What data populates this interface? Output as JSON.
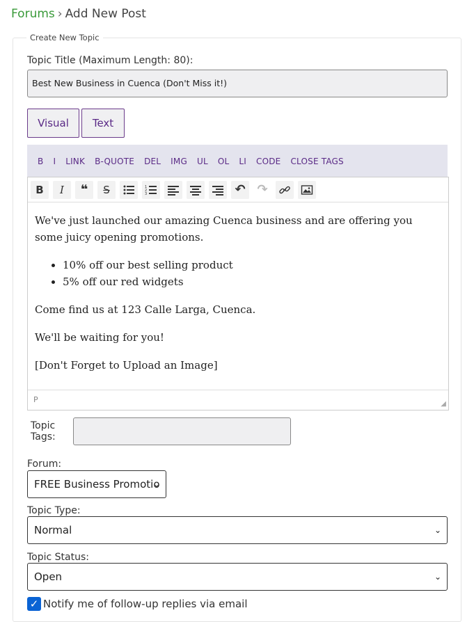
{
  "breadcrumb": {
    "root": "Forums",
    "separator": "›",
    "current": "Add New Post"
  },
  "form": {
    "legend": "Create New Topic",
    "title_label": "Topic Title (Maximum Length: 80):",
    "title_value": "Best New Business in Cuenca (Don't Miss it!)",
    "tabs": {
      "visual": "Visual",
      "text": "Text"
    },
    "quicktags": [
      "B",
      "I",
      "LINK",
      "B-QUOTE",
      "DEL",
      "IMG",
      "UL",
      "OL",
      "LI",
      "CODE",
      "CLOSE TAGS"
    ],
    "toolbar_icons": [
      "bold-icon",
      "italic-icon",
      "blockquote-icon",
      "strikethrough-icon",
      "bullet-list-icon",
      "numbered-list-icon",
      "align-left-icon",
      "align-center-icon",
      "align-right-icon",
      "undo-icon",
      "redo-icon",
      "link-icon",
      "image-icon"
    ],
    "editor": {
      "p1": "We've just launched our amazing Cuenca business and are offering you some juicy opening promotions.",
      "list": [
        "10% off our best selling product",
        "5% off our red widgets"
      ],
      "p2": "Come find us at 123 Calle Larga, Cuenca.",
      "p3": "We'll be waiting for you!",
      "p4": "[Don't Forget to Upload an Image]",
      "status_path": "P"
    },
    "tags_label": "Topic Tags:",
    "tags_value": "",
    "forum_label": "Forum:",
    "forum_value": "FREE Business Promotio",
    "type_label": "Topic Type:",
    "type_value": "Normal",
    "status_label": "Topic Status:",
    "status_value": "Open",
    "notify_label": "Notify me of follow-up replies via email",
    "notify_checked": true
  }
}
